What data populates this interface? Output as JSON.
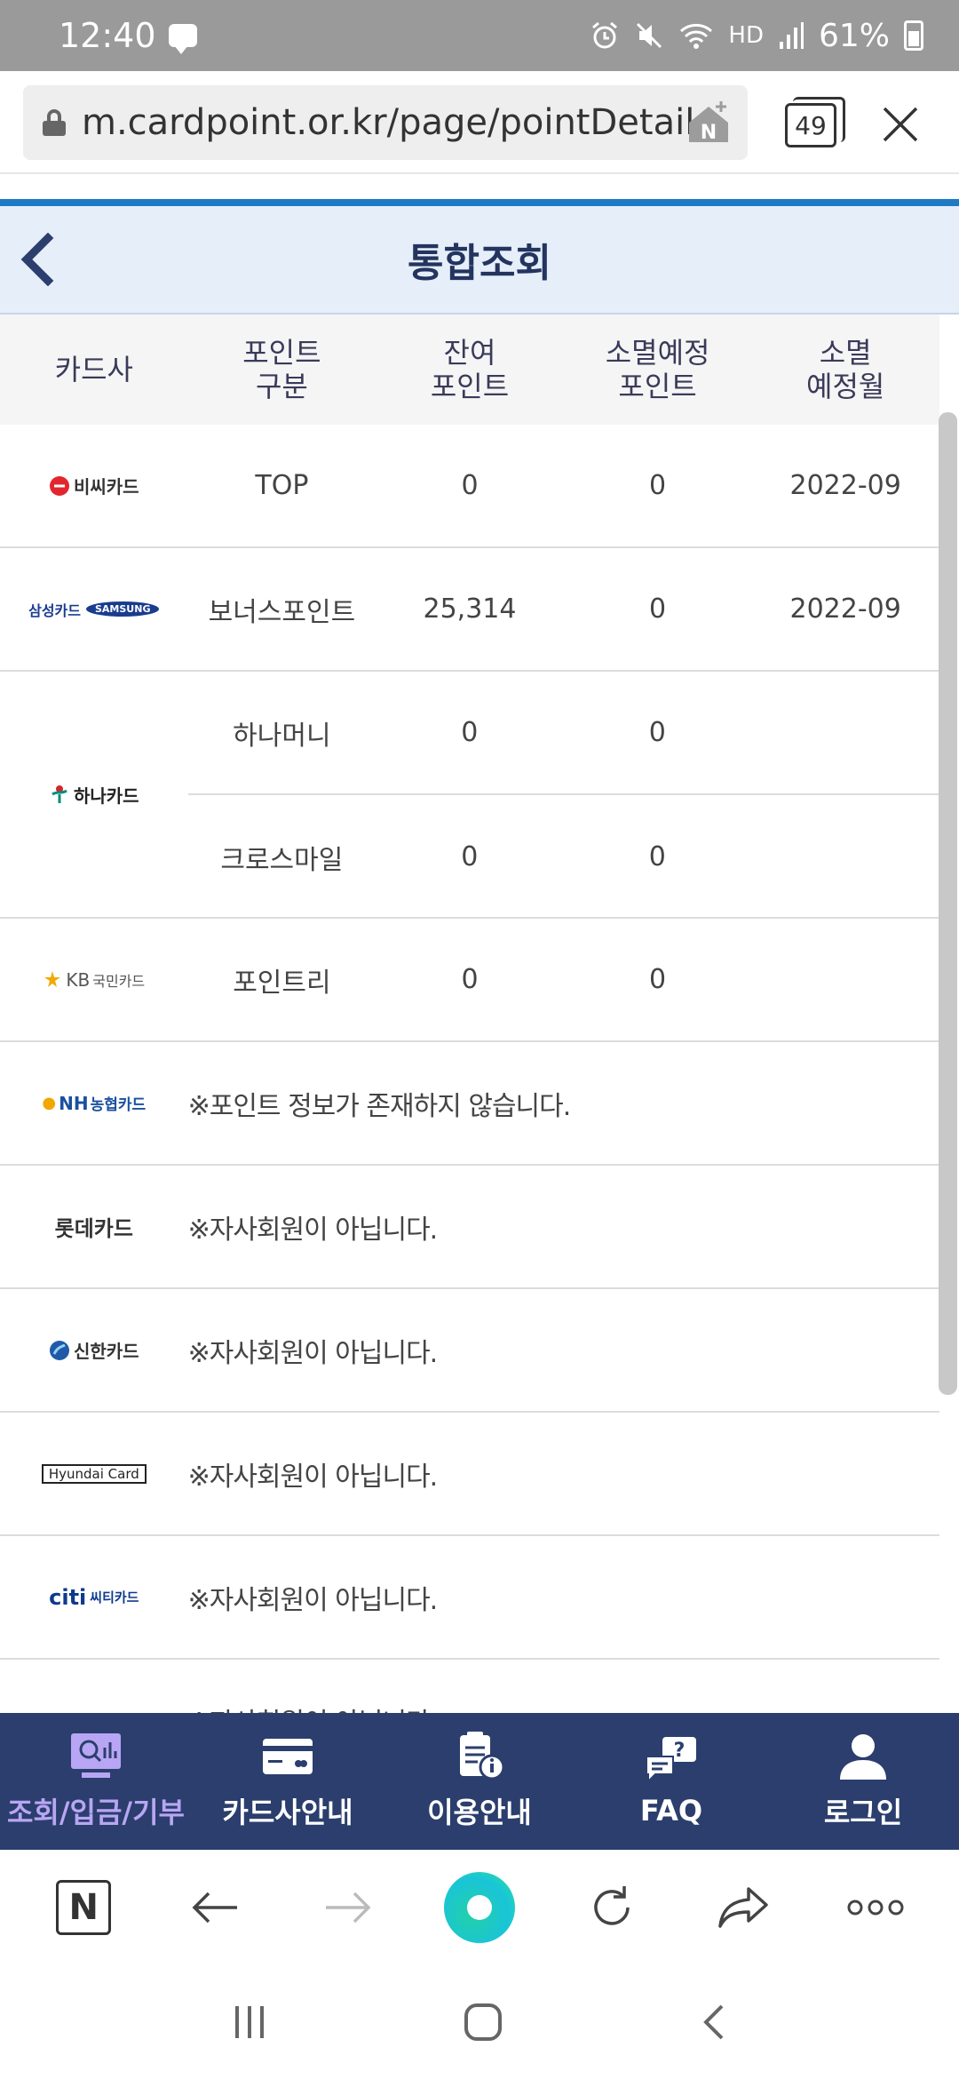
{
  "status_bar": {
    "time": "12:40",
    "hd_label": "HD",
    "battery": "61%"
  },
  "browser": {
    "url": "m.cardpoint.or.kr/page/pointDetail",
    "tab_count": "49"
  },
  "header": {
    "title": "통합조회"
  },
  "table": {
    "columns": [
      "카드사",
      "포인트\n구분",
      "잔여\n포인트",
      "소멸예정\n포인트",
      "소멸\n예정월"
    ],
    "bc": {
      "logo": "비씨카드",
      "type": "TOP",
      "remain": "0",
      "expire": "0",
      "month": "2022-09"
    },
    "samsung": {
      "logo_kr": "삼성카드",
      "logo_en": "SAMSUNG",
      "type": "보너스포인트",
      "remain": "25,314",
      "expire": "0",
      "month": "2022-09"
    },
    "hana": {
      "logo": "하나카드",
      "rows": [
        {
          "type": "하나머니",
          "remain": "0",
          "expire": "0"
        },
        {
          "type": "크로스마일",
          "remain": "0",
          "expire": "0"
        }
      ]
    },
    "kb": {
      "logo_a": "KB",
      "logo_b": "국민카드",
      "type": "포인트리",
      "remain": "0",
      "expire": "0"
    },
    "nh": {
      "logo_a": "NH",
      "logo_b": "농협카드",
      "message": "※포인트 정보가 존재하지 않습니다."
    },
    "lotte": {
      "logo": "롯데카드",
      "message": "※자사회원이 아닙니다."
    },
    "shinhan": {
      "logo": "신한카드",
      "message": "※자사회원이 아닙니다."
    },
    "hyundai": {
      "logo": "Hyundai Card",
      "message": "※자사회원이 아닙니다."
    },
    "citi": {
      "logo_a": "citi",
      "logo_b": "씨티카드",
      "message": "※자사회원이 아닙니다."
    },
    "partial": {
      "message": "※자사회원이 아닙니다."
    }
  },
  "bottom_nav": [
    "조회/입금/기부",
    "카드사안내",
    "이용안내",
    "FAQ",
    "로그인"
  ],
  "colors": {
    "accent_blue": "#1f7ac6",
    "nav_bg": "#2b3e6d",
    "nav_active": "#b8a6f4",
    "header_bg": "#e6eef9"
  }
}
